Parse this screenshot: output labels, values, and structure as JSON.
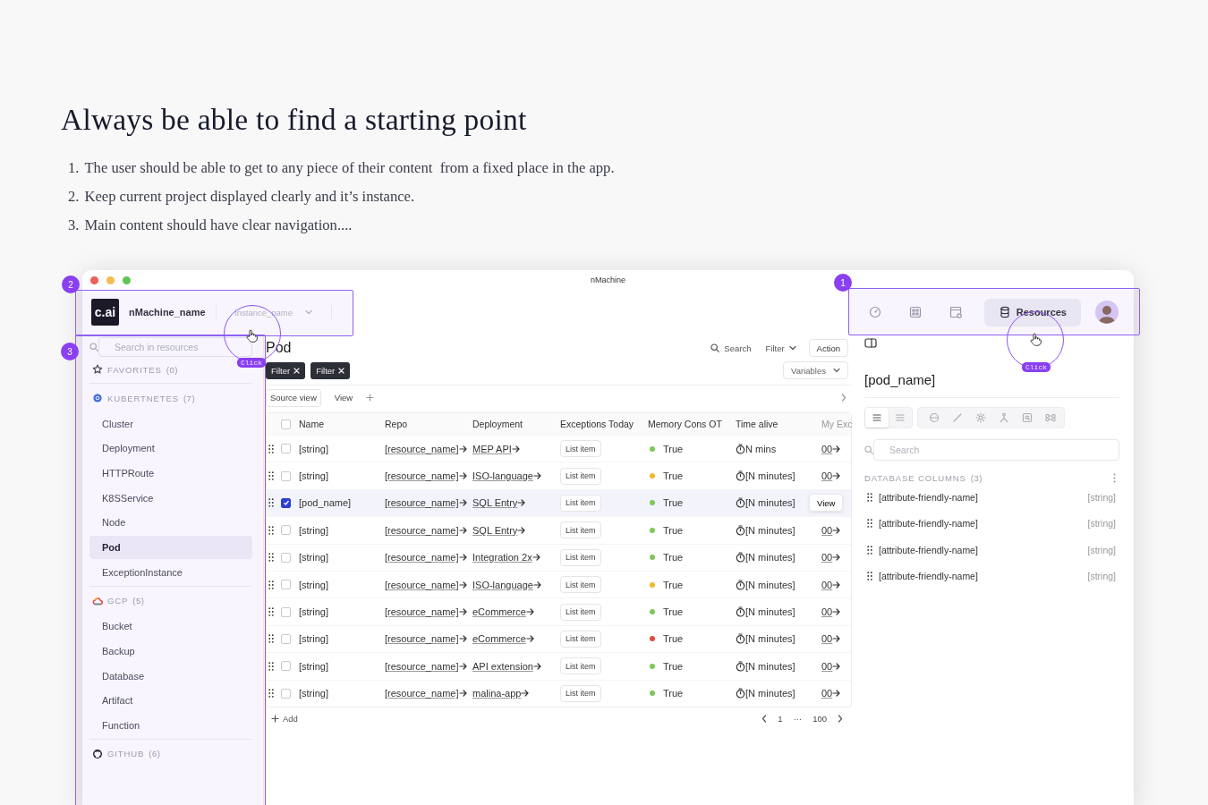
{
  "slide": {
    "title": "Always be able to find a starting point",
    "points": [
      {
        "number": "1.",
        "text": "The user should be able to get to any piece of their content  from a fixed place in the app."
      },
      {
        "number": "2.",
        "text": "Keep current project displayed clearly and it’s instance."
      },
      {
        "number": "3.",
        "text": "Main content should have clear navigation...."
      }
    ]
  },
  "window": {
    "title": "nMachine"
  },
  "header": {
    "logo": "c.ai",
    "machine_name": "nMachine_name",
    "instance": "instance_name"
  },
  "topnav": [
    {
      "selected": false
    },
    {
      "selected": false
    },
    {
      "selected": false
    },
    {
      "label": "Resources",
      "selected": true
    }
  ],
  "sidebar": {
    "search": {
      "placeholder": "Search in resources"
    },
    "groups": [
      {
        "title": "FAVORITES",
        "count": "(0)"
      },
      {
        "title": "KUBERTNETES",
        "count": "(7)",
        "items": [
          {
            "label": "Cluster",
            "selected": false
          },
          {
            "label": "Deployment",
            "selected": false
          },
          {
            "label": "HTTPRoute",
            "selected": false
          },
          {
            "label": "K8SService",
            "selected": false
          },
          {
            "label": "Node",
            "selected": false
          },
          {
            "label": "Pod",
            "selected": true
          },
          {
            "label": "ExceptionInstance",
            "selected": false
          }
        ]
      },
      {
        "title": "GCP",
        "count": "(5)",
        "items": [
          {
            "label": "Bucket",
            "selected": false
          },
          {
            "label": "Backup",
            "selected": false
          },
          {
            "label": "Database",
            "selected": false
          },
          {
            "label": "Artifact",
            "selected": false
          },
          {
            "label": "Function",
            "selected": false
          }
        ]
      },
      {
        "title": "GITHUB",
        "count": "(6)"
      }
    ]
  },
  "main": {
    "title": "Pod",
    "search": "Search",
    "filter": "Filter",
    "action": "Action",
    "chips": [
      "Filter",
      "Filter"
    ],
    "variables": "Variables",
    "views": [
      {
        "label": "Source view",
        "selected": true
      },
      {
        "label": "View",
        "selected": false
      }
    ],
    "table": {
      "header_checked": false,
      "columns": [
        "Name",
        "Repo",
        "Deployment",
        "Exceptions Today",
        "Memory Cons OT",
        "Time alive",
        "My Exc"
      ],
      "rows": [
        {
          "checked": false,
          "selected": false,
          "name": "[string]",
          "repo": "[resource_name]",
          "deployment": "MEP API",
          "exceptions": "List item",
          "status": {
            "color": "#7cc95a",
            "text": "True"
          },
          "time": "N mins",
          "my": "00"
        },
        {
          "checked": false,
          "selected": false,
          "name": "[string]",
          "repo": "[resource_name]",
          "deployment": "ISO-language",
          "exceptions": "List item",
          "status": {
            "color": "#f0b92b",
            "text": "True"
          },
          "time": "[N minutes]",
          "my": "00"
        },
        {
          "checked": true,
          "selected": true,
          "name": "[pod_name]",
          "repo": "[resource_name]",
          "deployment": "SQL Entry",
          "exceptions": "List item",
          "status": {
            "color": "#7cc95a",
            "text": "True"
          },
          "time": "[N minutes]",
          "action": "View"
        },
        {
          "checked": false,
          "selected": false,
          "name": "[string]",
          "repo": "[resource_name]",
          "deployment": "SQL Entry",
          "exceptions": "List item",
          "status": {
            "color": "#7cc95a",
            "text": "True"
          },
          "time": "[N minutes]",
          "my": "00"
        },
        {
          "checked": false,
          "selected": false,
          "name": "[string]",
          "repo": "[resource_name]",
          "deployment": "Integration 2x",
          "exceptions": "List item",
          "status": {
            "color": "#7cc95a",
            "text": "True"
          },
          "time": "[N minutes]",
          "my": "00"
        },
        {
          "checked": false,
          "selected": false,
          "name": "[string]",
          "repo": "[resource_name]",
          "deployment": "ISO-language",
          "exceptions": "List item",
          "status": {
            "color": "#f0b92b",
            "text": "True"
          },
          "time": "[N minutes]",
          "my": "00"
        },
        {
          "checked": false,
          "selected": false,
          "name": "[string]",
          "repo": "[resource_name]",
          "deployment": "eCommerce",
          "exceptions": "List item",
          "status": {
            "color": "#7cc95a",
            "text": "True"
          },
          "time": "[N minutes]",
          "my": "00"
        },
        {
          "checked": false,
          "selected": false,
          "name": "[string]",
          "repo": "[resource_name]",
          "deployment": "eCommerce",
          "exceptions": "List item",
          "status": {
            "color": "#e2483d",
            "text": "True"
          },
          "time": "[N minutes]",
          "my": "00"
        },
        {
          "checked": false,
          "selected": false,
          "name": "[string]",
          "repo": "[resource_name]",
          "deployment": "API extension",
          "exceptions": "List item",
          "status": {
            "color": "#7cc95a",
            "text": "True"
          },
          "time": "[N minutes]",
          "my": "00"
        },
        {
          "checked": false,
          "selected": false,
          "name": "[string]",
          "repo": "[resource_name]",
          "deployment": "malina-app",
          "exceptions": "List item",
          "status": {
            "color": "#7cc95a",
            "text": "True"
          },
          "time": "[N minutes]",
          "my": "00"
        }
      ]
    },
    "add": "Add",
    "pages": [
      "1",
      "···",
      "100"
    ]
  },
  "panel": {
    "title": "[pod_name]",
    "modes": [
      {
        "selected": true
      },
      {
        "selected": false
      }
    ],
    "search": {
      "placeholder": "Search"
    },
    "section": {
      "title": "DATABASE COLUMNS",
      "count": "(3)"
    },
    "columns": [
      {
        "name": "[attribute-friendly-name]",
        "type": "[string]"
      },
      {
        "name": "[attribute-friendly-name]",
        "type": "[string]"
      },
      {
        "name": "[attribute-friendly-name]",
        "type": "[string]"
      },
      {
        "name": "[attribute-friendly-name]",
        "type": "[string]"
      }
    ]
  },
  "annotations": [
    {
      "number": "2"
    },
    {
      "number": "1"
    },
    {
      "number": "3"
    }
  ],
  "clicks": [
    {
      "label": "Click"
    },
    {
      "label": "Click"
    }
  ]
}
